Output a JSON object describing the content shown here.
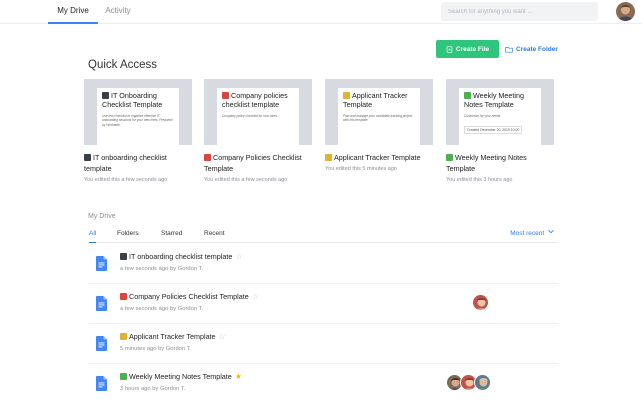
{
  "nav": {
    "tabs": [
      {
        "label": "My Drive",
        "active": true
      },
      {
        "label": "Activity",
        "active": false
      }
    ],
    "search_placeholder": "Search for anything you want ..."
  },
  "actions": {
    "create_file": "Create File",
    "create_folder": "Create Folder"
  },
  "quick_access": {
    "title": "Quick Access",
    "cards": [
      {
        "thumb_title": "IT Onboarding Checklist Template",
        "thumb_desc": "Use this checklist to organize effective IT onboarding sessions for your new hires. Prepared by Workable.",
        "thumb_meta": "",
        "title": "IT onboarding checklist template",
        "subtitle": "You edited this a few seconds ago",
        "emoji_color": "#3a3f47"
      },
      {
        "thumb_title": "Company policies checklist template",
        "thumb_desc": "Company policy checklist for new hires",
        "thumb_meta": "",
        "title": "Company Policies Checklist Template",
        "subtitle": "You edited this a few seconds ago",
        "emoji_color": "#d8463c"
      },
      {
        "thumb_title": "Applicant Tracker Template",
        "thumb_desc": "Plan and manage your candidate tracking project with this template",
        "thumb_meta": "",
        "title": "Applicant Tracker Template",
        "subtitle": "You edited this 5 minutes ago",
        "emoji_color": "#e0b232"
      },
      {
        "thumb_title": "Weekly Meeting Notes Template",
        "thumb_desc": "Customize for your needs",
        "thumb_meta": "Created December 20, 2019 10:00",
        "title": "Weekly Meeting Notes Template",
        "subtitle": "You edited this 3 hours ago",
        "emoji_color": "#4caf50"
      }
    ]
  },
  "drive": {
    "title": "My Drive",
    "filters": [
      "All",
      "Folders",
      "Starred",
      "Recent"
    ],
    "sort_label": "Most recent",
    "files": [
      {
        "title": "IT onboarding checklist template",
        "time": "a few seconds ago",
        "by": "by",
        "author": "Gordon T.",
        "starred": false,
        "emoji_color": "#3a3f47"
      },
      {
        "title": "Company Policies Checklist Template",
        "time": "a few seconds ago",
        "by": "by",
        "author": "Gordon T.",
        "starred": false,
        "emoji_color": "#d8463c"
      },
      {
        "title": "Applicant Tracker Template",
        "time": "5 minutes ago",
        "by": "by",
        "author": "Gordon T.",
        "starred": false,
        "emoji_color": "#e0b232"
      },
      {
        "title": "Weekly Meeting Notes Template",
        "time": "3 hours ago",
        "by": "by",
        "author": "Gordon T.",
        "starred": true,
        "emoji_color": "#4caf50"
      }
    ]
  },
  "colors": {
    "accent": "#2d7be5",
    "create_button": "#2fc57d",
    "star_on": "#f5b800"
  }
}
